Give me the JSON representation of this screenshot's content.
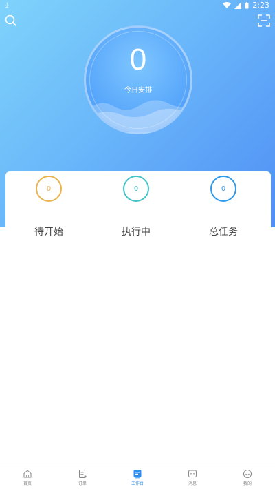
{
  "status": {
    "time": "2:23"
  },
  "dial": {
    "value": "0",
    "label": "今日安排"
  },
  "stats": [
    {
      "value": "0",
      "label": "待开始",
      "color": "#e9b44c"
    },
    {
      "value": "0",
      "label": "执行中",
      "color": "#41c3c8"
    },
    {
      "value": "0",
      "label": "总任务",
      "color": "#2e9ae8"
    }
  ],
  "tabs": [
    {
      "label": "首页",
      "icon": "home-icon"
    },
    {
      "label": "订单",
      "icon": "order-icon"
    },
    {
      "label": "工作台",
      "icon": "workbench-icon",
      "active": true
    },
    {
      "label": "消息",
      "icon": "message-icon"
    },
    {
      "label": "我的",
      "icon": "profile-icon"
    }
  ],
  "colors": {
    "accent": "#2e8ff0"
  }
}
